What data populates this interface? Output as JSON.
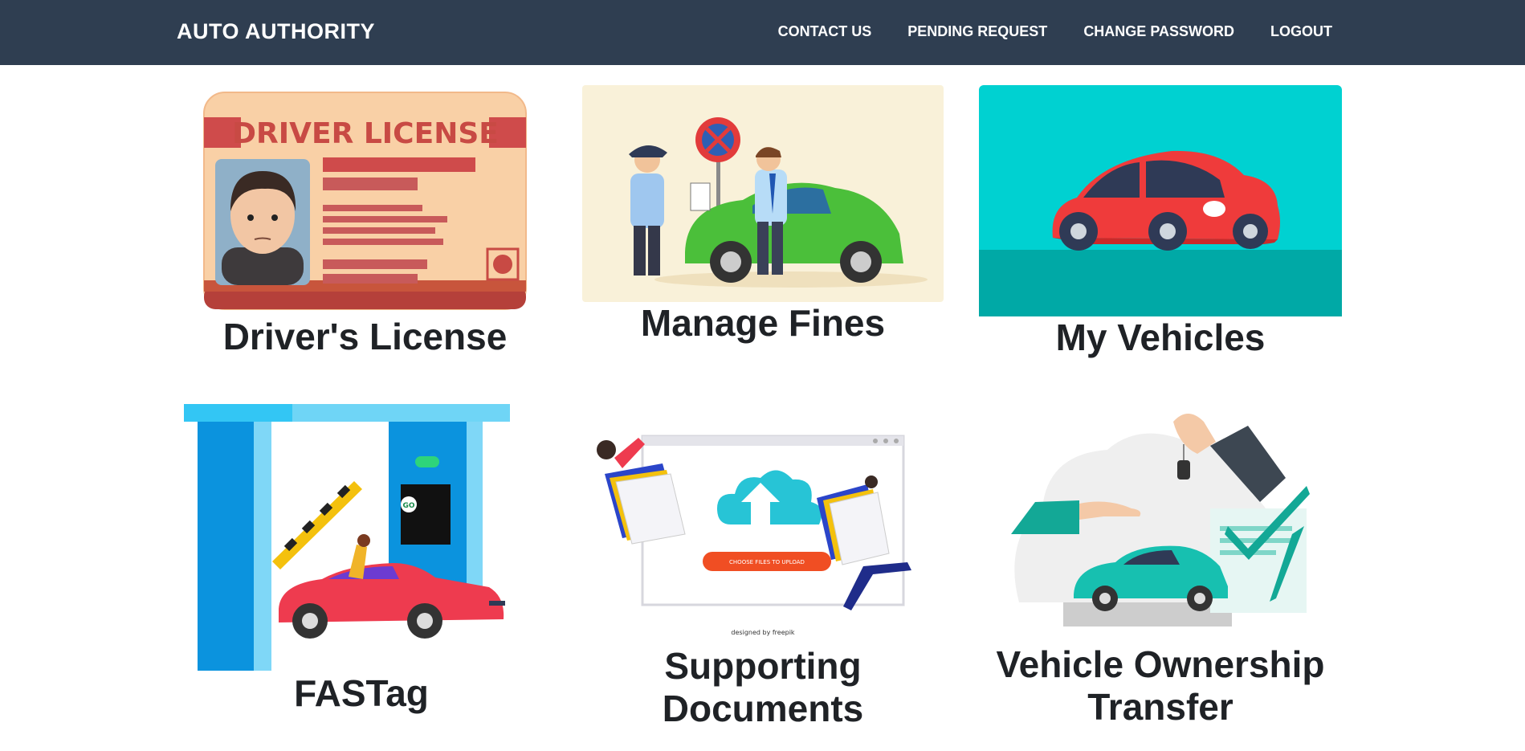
{
  "navbar": {
    "brand": "AUTO AUTHORITY",
    "links": [
      "CONTACT US",
      "PENDING REQUEST",
      "CHANGE PASSWORD",
      "LOGOUT"
    ]
  },
  "cards": [
    {
      "title": "Driver's License",
      "image": "driver-license-illustration",
      "image_text": "DRIVER LICENSE"
    },
    {
      "title": "Manage Fines",
      "image": "traffic-police-fine-illustration"
    },
    {
      "title": "My Vehicles",
      "image": "red-car-illustration"
    },
    {
      "title": "FASTag",
      "image": "toll-booth-illustration",
      "image_text": "GO"
    },
    {
      "title": "Supporting Documents",
      "image": "file-upload-illustration",
      "image_text": "CHOOSE FILES TO UPLOAD",
      "image_credit": "designed by freepik"
    },
    {
      "title": "Vehicle Ownership Transfer",
      "image": "ownership-transfer-illustration"
    }
  ],
  "colors": {
    "navbar": "#2f3e51",
    "nav_text": "#ffffff",
    "title_text": "#1f2226"
  }
}
